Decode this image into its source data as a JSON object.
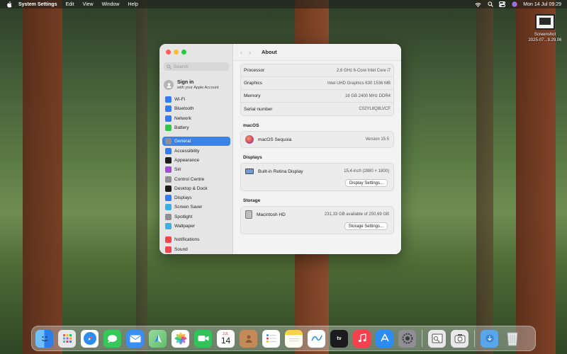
{
  "menubar": {
    "app": "System Settings",
    "menus": [
      "Edit",
      "View",
      "Window",
      "Help"
    ],
    "clock": "Mon 14 Jul  09:29"
  },
  "desktop": {
    "file_name_line1": "Screenshot",
    "file_name_line2": "2025-07...9.29.06"
  },
  "window": {
    "title": "About",
    "search_placeholder": "Search",
    "signin": {
      "title": "Sign in",
      "subtitle": "with your Apple Account"
    },
    "sidebar": [
      {
        "label": "Wi-Fi",
        "icon": "wifi-icon",
        "color": "#2f7cf6"
      },
      {
        "label": "Bluetooth",
        "icon": "bluetooth-icon",
        "color": "#2f7cf6"
      },
      {
        "label": "Network",
        "icon": "network-icon",
        "color": "#2f7cf6"
      },
      {
        "label": "Battery",
        "icon": "battery-icon",
        "color": "#33c748"
      },
      {
        "label": "General",
        "icon": "gear-icon",
        "color": "#8e8e93"
      },
      {
        "label": "Accessibility",
        "icon": "accessibility-icon",
        "color": "#2f7cf6"
      },
      {
        "label": "Appearance",
        "icon": "appearance-icon",
        "color": "#1c1c1e"
      },
      {
        "label": "Siri",
        "icon": "siri-icon",
        "color": "#a44bd8"
      },
      {
        "label": "Control Centre",
        "icon": "control-centre-icon",
        "color": "#8e8e93"
      },
      {
        "label": "Desktop & Dock",
        "icon": "desktop-dock-icon",
        "color": "#1c1c1e"
      },
      {
        "label": "Displays",
        "icon": "displays-icon",
        "color": "#2f7cf6"
      },
      {
        "label": "Screen Saver",
        "icon": "screen-saver-icon",
        "color": "#39b0e8"
      },
      {
        "label": "Spotlight",
        "icon": "spotlight-icon",
        "color": "#8e8e93"
      },
      {
        "label": "Wallpaper",
        "icon": "wallpaper-icon",
        "color": "#39b0e8"
      },
      {
        "label": "Notifications",
        "icon": "notifications-icon",
        "color": "#f2444a"
      },
      {
        "label": "Sound",
        "icon": "sound-icon",
        "color": "#f2444a"
      }
    ],
    "specs": [
      {
        "label": "Processor",
        "value": "2,6 GHz 6-Core Intel Core i7"
      },
      {
        "label": "Graphics",
        "value": "Intel UHD Graphics 630 1536 MB"
      },
      {
        "label": "Memory",
        "value": "16 GB 2400 MHz DDR4"
      },
      {
        "label": "Serial number",
        "value": "C02YL8Q8LVCF"
      }
    ],
    "macos": {
      "heading": "macOS",
      "name": "macOS Sequoia",
      "version": "Version 15.5"
    },
    "displays": {
      "heading": "Displays",
      "name": "Built-in Retina Display",
      "detail": "15,4-inch (2880 × 1800)",
      "button": "Display Settings..."
    },
    "storage": {
      "heading": "Storage",
      "name": "Macintosh HD",
      "detail": "231,33 GB available of 250,69 GB",
      "button": "Storage Settings..."
    }
  },
  "dock": {
    "calendar_month": "JUL",
    "calendar_day": "14",
    "apps": [
      {
        "name": "finder-icon",
        "color": "#3a8ef0"
      },
      {
        "name": "launchpad-icon",
        "color": "#e8e8e8"
      },
      {
        "name": "safari-icon",
        "color": "#2d8cf0"
      },
      {
        "name": "messages-icon",
        "color": "#35c759"
      },
      {
        "name": "mail-icon",
        "color": "#3b8ef2"
      },
      {
        "name": "maps-icon",
        "color": "#5fbf6a"
      },
      {
        "name": "photos-icon",
        "color": "#f5f5f5"
      },
      {
        "name": "facetime-icon",
        "color": "#31c25a"
      },
      {
        "name": "calendar-icon",
        "color": "#ffffff"
      },
      {
        "name": "contacts-icon",
        "color": "#b47a4c"
      },
      {
        "name": "reminders-icon",
        "color": "#ffffff"
      },
      {
        "name": "notes-icon",
        "color": "#f7d14a"
      },
      {
        "name": "freeform-icon",
        "color": "#ffffff"
      },
      {
        "name": "apple-tv-icon",
        "color": "#1c1c1e"
      },
      {
        "name": "music-icon",
        "color": "#f5404e"
      },
      {
        "name": "app-store-icon",
        "color": "#2d8cf0"
      },
      {
        "name": "system-settings-icon",
        "color": "#8e8e93"
      },
      {
        "name": "preview-icon",
        "color": "#e9e9e9"
      },
      {
        "name": "screenshot-tool-icon",
        "color": "#e9e9e9"
      },
      {
        "name": "downloads-folder-icon",
        "color": "#5aa6e8"
      },
      {
        "name": "trash-icon",
        "color": "#d9dcdc"
      }
    ]
  }
}
